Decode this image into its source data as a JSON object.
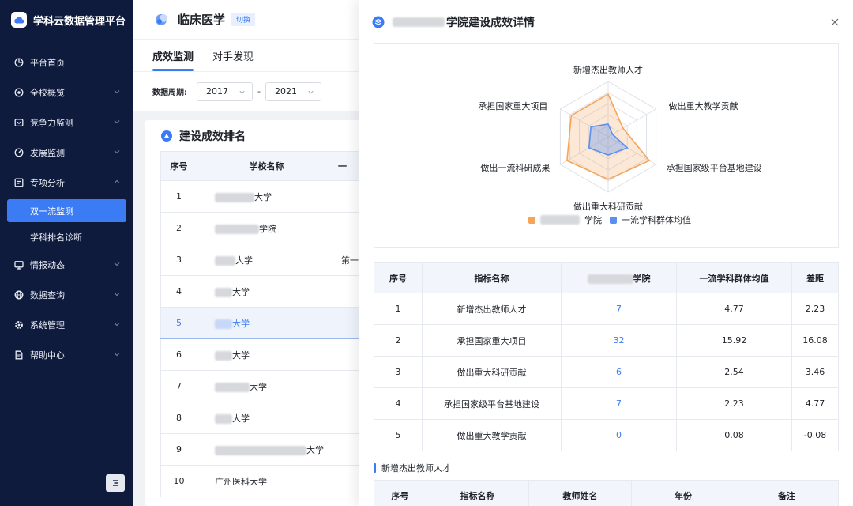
{
  "app": {
    "title": "学科云数据管理平台"
  },
  "sidebar": {
    "items": [
      {
        "label": "平台首页",
        "icon": "pie-chart-icon",
        "has_children": false
      },
      {
        "label": "全校概览",
        "icon": "target-icon",
        "has_children": true
      },
      {
        "label": "竞争力监测",
        "icon": "inbox-icon",
        "has_children": true
      },
      {
        "label": "发展监测",
        "icon": "gauge-icon",
        "has_children": true
      },
      {
        "label": "专项分析",
        "icon": "layout-icon",
        "has_children": true,
        "expanded": true
      }
    ],
    "sub_items": [
      {
        "label": "双一流监测",
        "active": true
      },
      {
        "label": "学科排名诊断",
        "active": false
      }
    ],
    "items_after": [
      {
        "label": "情报动态",
        "icon": "monitor-icon",
        "has_children": true
      },
      {
        "label": "数据查询",
        "icon": "globe-icon",
        "has_children": true
      },
      {
        "label": "系统管理",
        "icon": "settings-icon",
        "has_children": true
      },
      {
        "label": "帮助中心",
        "icon": "document-icon",
        "has_children": true
      }
    ]
  },
  "header": {
    "title": "临床医学",
    "switch_label": "切换"
  },
  "tabs": [
    {
      "label": "成效监测",
      "active": true
    },
    {
      "label": "对手发现",
      "active": false
    }
  ],
  "filter": {
    "label": "数据周期:",
    "start": "2017",
    "separator": "-",
    "end": "2021"
  },
  "ranking": {
    "title": "建设成效排名",
    "headers": [
      "序号",
      "学校名称",
      "一"
    ],
    "rows": [
      {
        "idx": "1",
        "name_suffix": "大学",
        "blur_w": 50,
        "extra": ""
      },
      {
        "idx": "2",
        "name_suffix": "学院",
        "blur_w": 56,
        "extra": ""
      },
      {
        "idx": "3",
        "name_suffix": "大学",
        "blur_w": 26,
        "extra": "第一"
      },
      {
        "idx": "4",
        "name_suffix": "大学",
        "blur_w": 22,
        "extra": ""
      },
      {
        "idx": "5",
        "name_suffix": "大学",
        "blur_w": 22,
        "extra": "",
        "highlight": true
      },
      {
        "idx": "6",
        "name_suffix": "大学",
        "blur_w": 22,
        "extra": ""
      },
      {
        "idx": "7",
        "name_suffix": "大学",
        "blur_w": 44,
        "extra": ""
      },
      {
        "idx": "8",
        "name_suffix": "大学",
        "blur_w": 22,
        "extra": ""
      },
      {
        "idx": "9",
        "name_suffix": "大学",
        "blur_w": 116,
        "extra": ""
      },
      {
        "idx": "10",
        "name_suffix": "广州医科大学",
        "blur_w": 0,
        "extra": ""
      }
    ]
  },
  "drawer": {
    "title_suffix": "学院建设成效详情",
    "chart_data": {
      "type": "radar",
      "indicators": [
        "新增杰出教师人才",
        "做出重大教学贡献",
        "承担国家级平台基地建设",
        "做出重大科研贡献",
        "做出一流科研成果",
        "承担国家重大项目"
      ],
      "series": [
        {
          "name_suffix": "学院",
          "color": "#f5a55b"
        },
        {
          "name": "一流学科群体均值",
          "color": "#5a8ff2"
        }
      ]
    },
    "table": {
      "headers": [
        "序号",
        "指标名称",
        "学院",
        "一流学科群体均值",
        "差距"
      ],
      "rows": [
        {
          "idx": "1",
          "name": "新增杰出教师人才",
          "value": "7",
          "avg": "4.77",
          "gap": "2.23"
        },
        {
          "idx": "2",
          "name": "承担国家重大项目",
          "value": "32",
          "avg": "15.92",
          "gap": "16.08"
        },
        {
          "idx": "3",
          "name": "做出重大科研贡献",
          "value": "6",
          "avg": "2.54",
          "gap": "3.46"
        },
        {
          "idx": "4",
          "name": "承担国家级平台基地建设",
          "value": "7",
          "avg": "2.23",
          "gap": "4.77"
        },
        {
          "idx": "5",
          "name": "做出重大教学贡献",
          "value": "0",
          "avg": "0.08",
          "gap": "-0.08"
        }
      ]
    },
    "section": {
      "title": "新增杰出教师人才",
      "headers": [
        "序号",
        "指标名称",
        "教师姓名",
        "年份",
        "备注"
      ]
    }
  },
  "colors": {
    "accent": "#3b7cf5",
    "sidebar_bg": "#0f1b3d",
    "orange": "#f5a55b"
  }
}
